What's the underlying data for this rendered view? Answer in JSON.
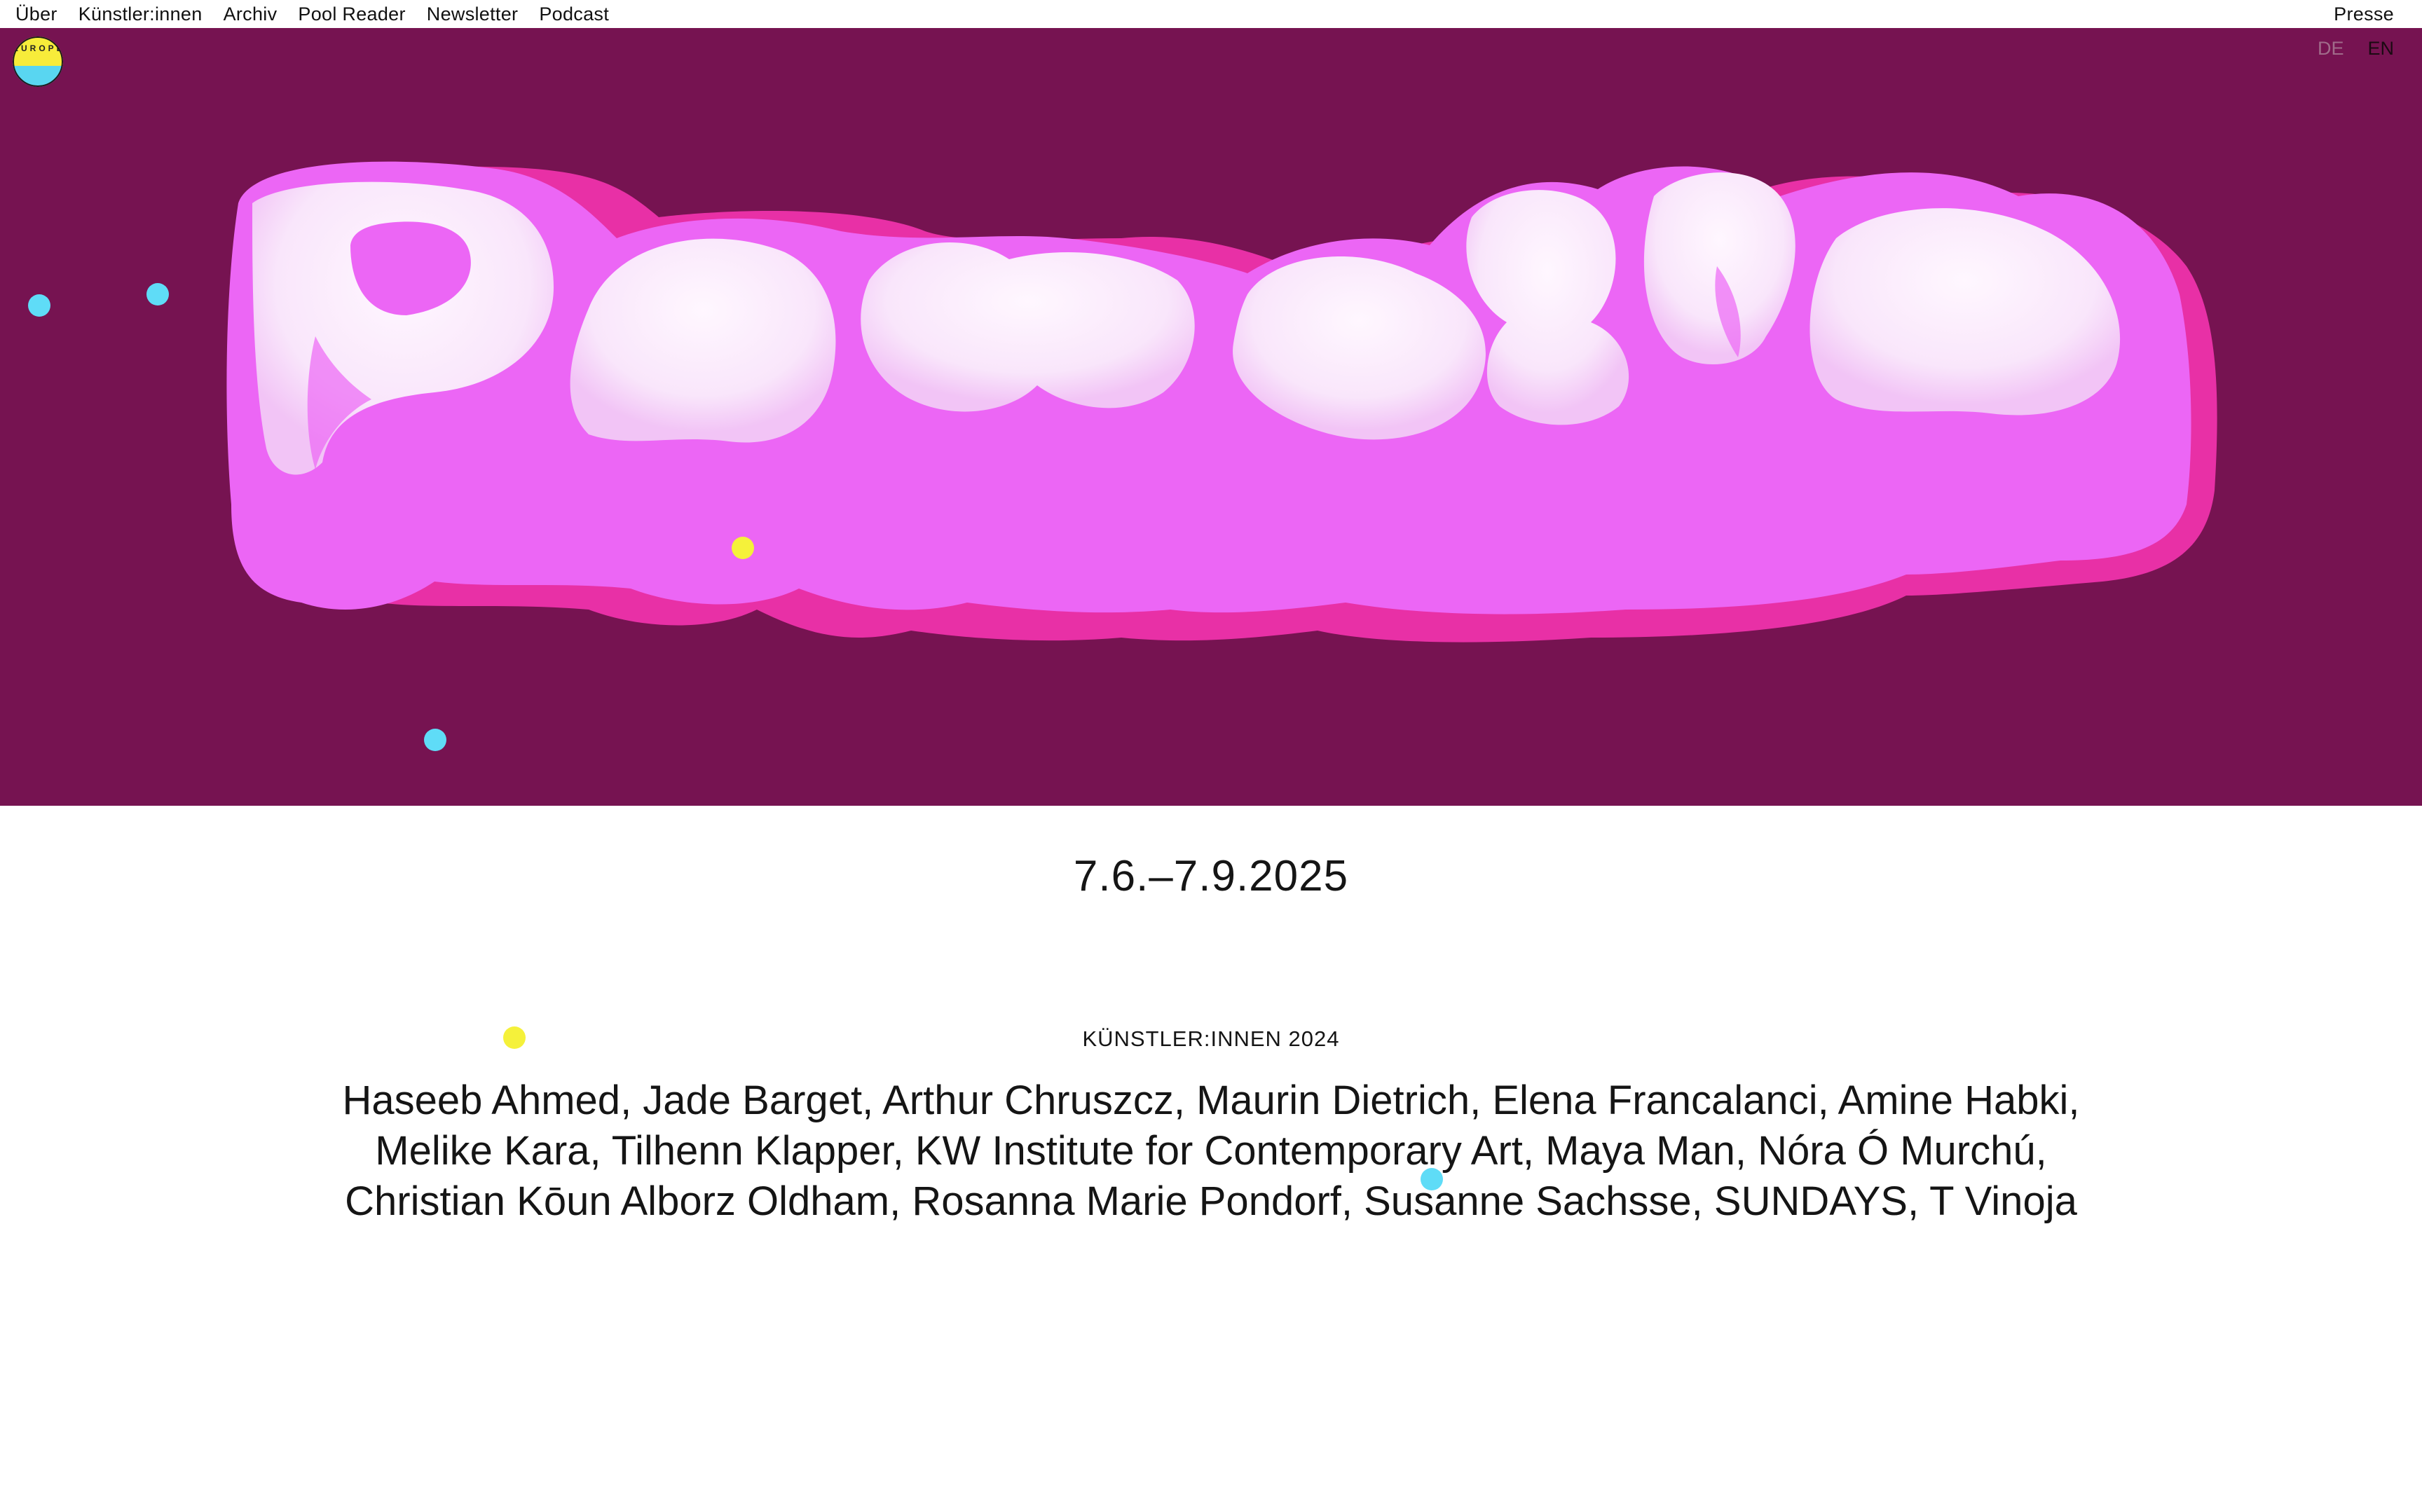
{
  "nav": {
    "items": [
      "Über",
      "Künstler:innen",
      "Archiv",
      "Pool Reader",
      "Newsletter",
      "Podcast"
    ],
    "right_link": "Presse"
  },
  "logo": {
    "text": "EUROPEZ",
    "icon": "circle-logo-icon"
  },
  "language": {
    "de": "DE",
    "en": "EN",
    "active": "EN"
  },
  "hero": {
    "title": "Parasite",
    "colors": {
      "background": "#761351",
      "blob_shadow": "#e830a6",
      "blob_main": "#ec66f5",
      "highlight": "#fbeefb"
    }
  },
  "date": "7.6.–7.9.2025",
  "artists_section": {
    "label": "KÜNSTLER:INNEN 2024",
    "names": "Haseeb Ahmed, Jade Barget, Arthur Chruszcz, Maurin Dietrich, Elena Francalanci, Amine Habki, Melike Kara, Tilhenn Klapper, KW Institute for Contemporary Art, Maya Man, Nóra Ó Murchú, Christian Kōun Alborz Oldham, Rosanna Marie Pondorf, Susanne Sachsse, SUNDAYS, T Vinoja"
  },
  "accent_colors": {
    "cyan": "#5fdcf7",
    "yellow": "#f5f13a"
  }
}
